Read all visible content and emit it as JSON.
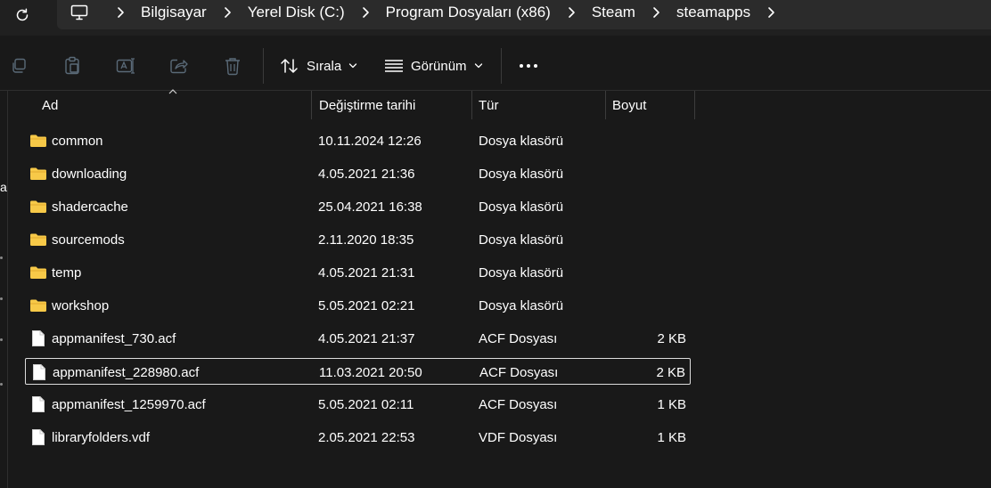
{
  "breadcrumbs": [
    "Bilgisayar",
    "Yerel Disk (C:)",
    "Program Dosyaları (x86)",
    "Steam",
    "steamapps"
  ],
  "toolbar": {
    "sort_label": "Sırala",
    "view_label": "Görünüm",
    "icons": [
      "copy-icon",
      "paste-icon",
      "rename-icon",
      "share-icon",
      "delete-icon",
      "sort-icon",
      "view-icon",
      "more-icon"
    ]
  },
  "columns": {
    "name": "Ad",
    "date": "Değiştirme tarihi",
    "type": "Tür",
    "size": "Boyut"
  },
  "left_pane": {
    "cut_text": "a"
  },
  "files": [
    {
      "name": "common",
      "date": "10.11.2024 12:26",
      "type": "Dosya klasörü",
      "size": "",
      "kind": "folder"
    },
    {
      "name": "downloading",
      "date": "4.05.2021 21:36",
      "type": "Dosya klasörü",
      "size": "",
      "kind": "folder"
    },
    {
      "name": "shadercache",
      "date": "25.04.2021 16:38",
      "type": "Dosya klasörü",
      "size": "",
      "kind": "folder"
    },
    {
      "name": "sourcemods",
      "date": "2.11.2020 18:35",
      "type": "Dosya klasörü",
      "size": "",
      "kind": "folder"
    },
    {
      "name": "temp",
      "date": "4.05.2021 21:31",
      "type": "Dosya klasörü",
      "size": "",
      "kind": "folder"
    },
    {
      "name": "workshop",
      "date": "5.05.2021 02:21",
      "type": "Dosya klasörü",
      "size": "",
      "kind": "folder"
    },
    {
      "name": "appmanifest_730.acf",
      "date": "4.05.2021 21:37",
      "type": "ACF Dosyası",
      "size": "2 KB",
      "kind": "file"
    },
    {
      "name": "appmanifest_228980.acf",
      "date": "11.03.2021 20:50",
      "type": "ACF Dosyası",
      "size": "2 KB",
      "kind": "file",
      "selected": true
    },
    {
      "name": "appmanifest_1259970.acf",
      "date": "5.05.2021 02:11",
      "type": "ACF Dosyası",
      "size": "1 KB",
      "kind": "file"
    },
    {
      "name": "libraryfolders.vdf",
      "date": "2.05.2021 22:53",
      "type": "VDF Dosyası",
      "size": "1 KB",
      "kind": "file"
    }
  ],
  "colors": {
    "background": "#191919",
    "address_bar": "#2b2b2b",
    "folder": "#f7c948",
    "selection_border": "#dcdcdc"
  }
}
